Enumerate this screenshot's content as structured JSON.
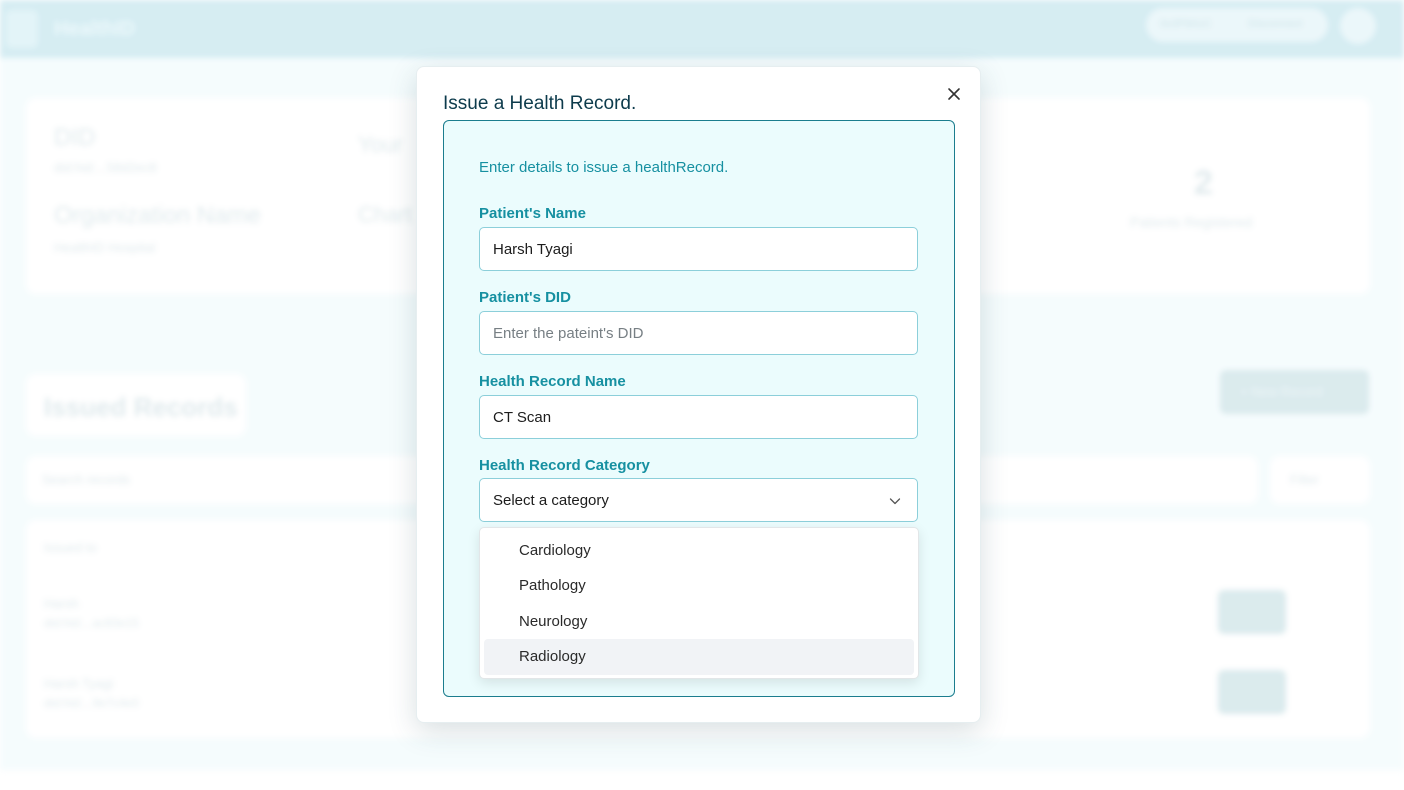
{
  "background": {
    "brand": "HealthID",
    "wallet_left": "0x3F8A1C",
    "wallet_right": "Disconnect",
    "info_labels": {
      "did_label": "DID",
      "did_value": "did:hid:...58d2ec8",
      "org_label": "Organization Name",
      "org_value": "HealthID Hospital",
      "your_label": "Your",
      "chart_label": "Chart",
      "stat_number": "2",
      "stat_label": "Patients Registered"
    },
    "issued_records_heading": "Issued Records",
    "search_placeholder": "Search records",
    "new_record_button": "+ New Record",
    "filter_button": "Filter",
    "table_header": "Issued to",
    "rows": [
      {
        "name": "Harsh",
        "did": "did:hid:...ac83e15"
      },
      {
        "name": "Harsh Tyagi",
        "did": "did:hid:...9e7c4e0"
      }
    ],
    "view_label": "View"
  },
  "modal": {
    "title": "Issue a Health Record.",
    "intro": "Enter details to issue a healthRecord.",
    "patient_name_label": "Patient's Name",
    "patient_name_value": "Harsh Tyagi",
    "patient_did_label": "Patient's DID",
    "patient_did_placeholder": "Enter the pateint's DID",
    "record_name_label": "Health Record Name",
    "record_name_value": "CT Scan",
    "category_label": "Health Record Category",
    "category_selected": "Select a category",
    "category_options": [
      "Cardiology",
      "Pathology",
      "Neurology",
      "Radiology"
    ],
    "highlighted_option": "Radiology"
  },
  "colors": {
    "accent": "#1690a1",
    "panel_border": "#1b7d8e",
    "panel_bg": "#ebfcfd",
    "title": "#0d3b4c"
  }
}
